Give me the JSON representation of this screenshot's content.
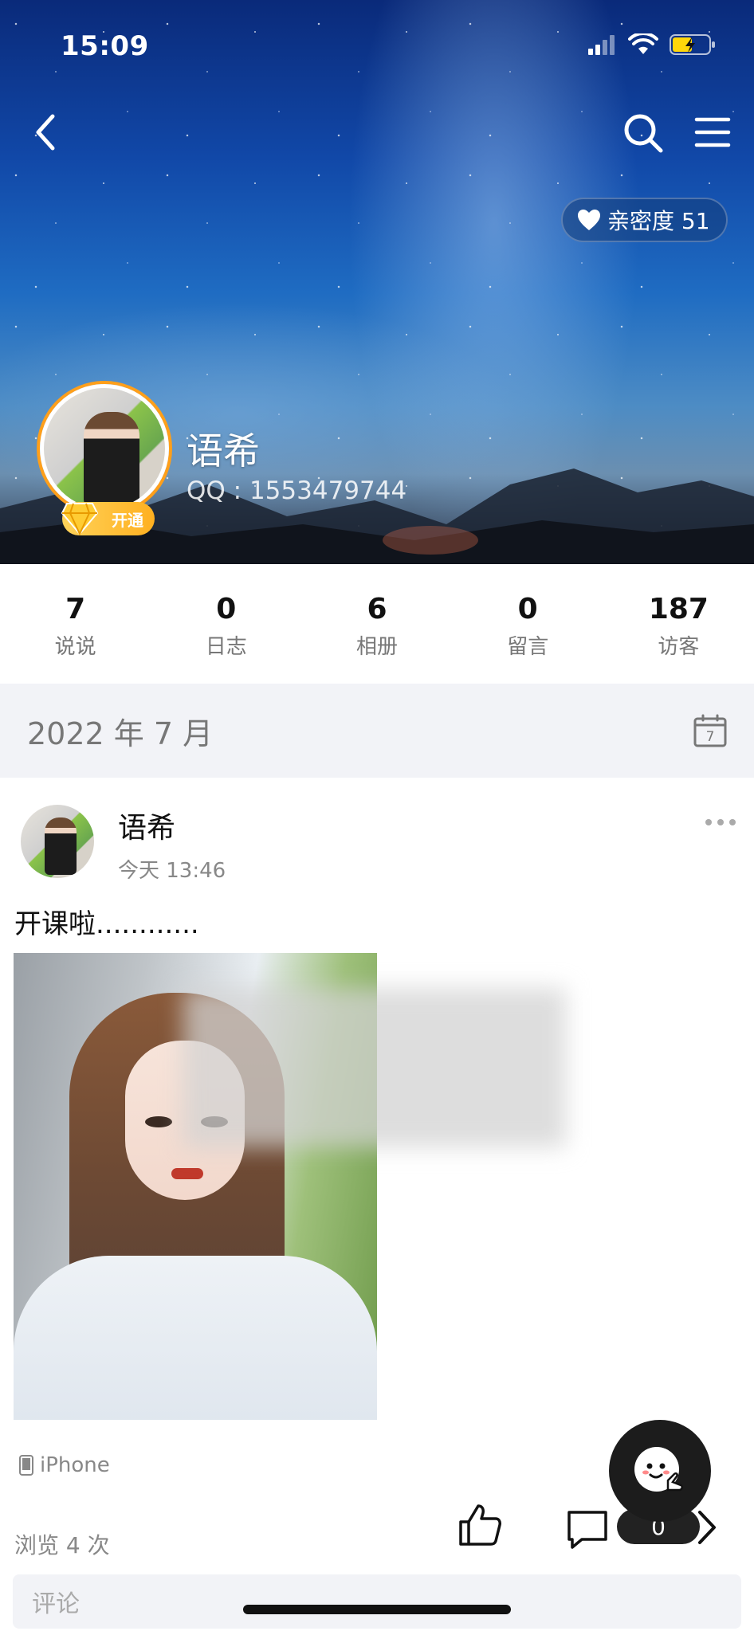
{
  "status_bar": {
    "time": "15:09"
  },
  "header": {
    "intimacy_label": "亲密度 51",
    "profile_name": "语希",
    "qq_label": "QQ : 1553479744",
    "vip_label": "开通"
  },
  "stats": [
    {
      "value": "7",
      "label": "说说"
    },
    {
      "value": "0",
      "label": "日志"
    },
    {
      "value": "6",
      "label": "相册"
    },
    {
      "value": "0",
      "label": "留言"
    },
    {
      "value": "187",
      "label": "访客"
    }
  ],
  "month_bar": {
    "title": "2022 年 7 月",
    "calendar_day": "7"
  },
  "post": {
    "author": "语希",
    "time": "今天 13:46",
    "text": "开课啦............",
    "device": "iPhone",
    "views": "浏览 4 次",
    "comment_count": "0"
  },
  "comment_box": {
    "placeholder": "评论"
  },
  "colors": {
    "accent_orange": "#ff9f1a",
    "count_pill": "#222222"
  },
  "icons": [
    "back-icon",
    "search-icon",
    "menu-icon",
    "heart-icon",
    "calendar-icon",
    "more-icon",
    "phone-icon",
    "like-icon",
    "comment-icon",
    "chevron-right-icon",
    "mascot-icon"
  ]
}
